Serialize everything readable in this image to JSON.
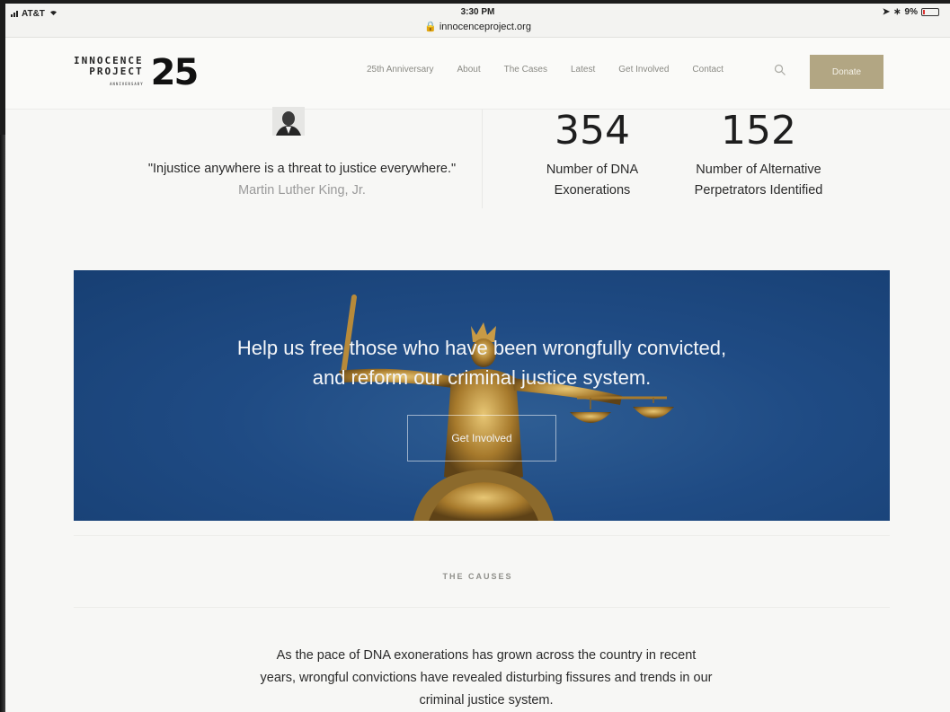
{
  "statusbar": {
    "carrier": "AT&T",
    "time": "3:30 PM",
    "url": "innocenceproject.org",
    "battery": "9%"
  },
  "header": {
    "logo_line1": "INNOCENCE",
    "logo_line2": "PROJECT",
    "logo_sub": "ANNIVERSARY",
    "logo_number": "25",
    "nav": [
      "25th Anniversary",
      "About",
      "The Cases",
      "Latest",
      "Get Involved",
      "Contact"
    ],
    "donate_label": "Donate"
  },
  "quote": {
    "text": "\"Injustice anywhere is a threat to justice everywhere.\"",
    "attribution": "Martin Luther King, Jr."
  },
  "stats": [
    {
      "number": "354",
      "label_line1": "Number of DNA",
      "label_line2": "Exonerations"
    },
    {
      "number": "152",
      "label_line1": "Number of Alternative",
      "label_line2": "Perpetrators Identified"
    }
  ],
  "hero": {
    "line1": "Help us free those who have been wrongfully convicted,",
    "line2": "and reform our criminal justice system.",
    "button_label": "Get Involved"
  },
  "causes": {
    "heading": "THE CAUSES",
    "text": "As the pace of DNA exonerations has grown across the country in recent years, wrongful convictions have revealed disturbing fissures and trends in our criminal justice system."
  },
  "colors": {
    "accent_gold": "#b2a683",
    "hero_blue": "#1f4b84"
  }
}
